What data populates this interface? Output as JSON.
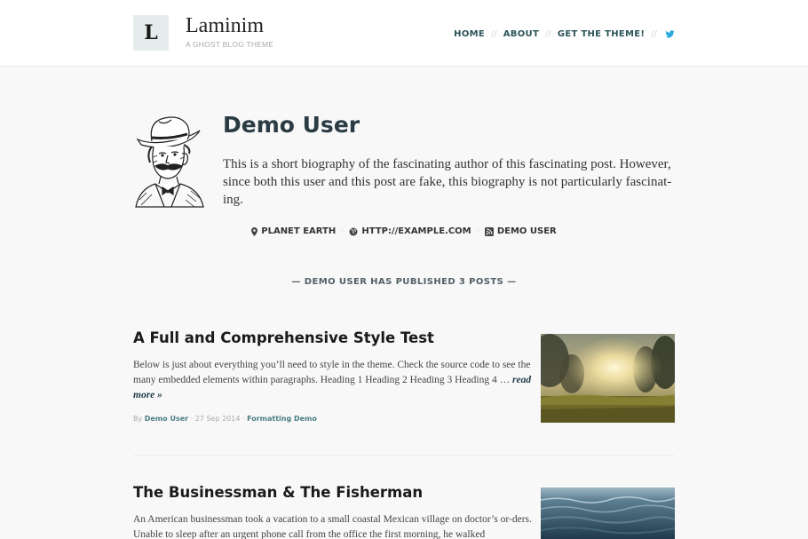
{
  "header": {
    "logo_letter": "L",
    "title": "Laminim",
    "tagline": "A GHOST BLOG THEME",
    "nav": [
      "HOME",
      "ABOUT",
      "GET THE THEME!"
    ],
    "twitter_icon": "twitter-icon",
    "nav_color": "#2b5459"
  },
  "author": {
    "name": "Demo User",
    "bio": "This is a short biography of the fascinating author of this fascinating post. However, since both this user and this post are fake, this biography is not particularly fascinat-ing.",
    "location": "PLANET EARTH",
    "website": "HTTP://EXAMPLE.COM",
    "rss_label": "DEMO USER",
    "posts_count_text": "— DEMO USER HAS PUBLISHED 3 POSTS —"
  },
  "posts": [
    {
      "title": "A Full and Comprehensive Style Test",
      "excerpt": "Below is just about everything you’ll need to style in the theme. Check the source code to see the many embedded elements within paragraphs. Heading 1 Heading 2 Heading 3 Heading 4 …",
      "read_more": "read more »",
      "by": "By",
      "author": "Demo User",
      "date": "27 Sep 2014",
      "tag": "Formatting Demo",
      "sep": "·"
    },
    {
      "title": "The Businessman & The Fisherman",
      "excerpt": "An American businessman took a vacation to a small coastal Mexican village on doctor’s or-ders. Unable to sleep after an urgent phone call from the office the first morning, he walked"
    }
  ]
}
